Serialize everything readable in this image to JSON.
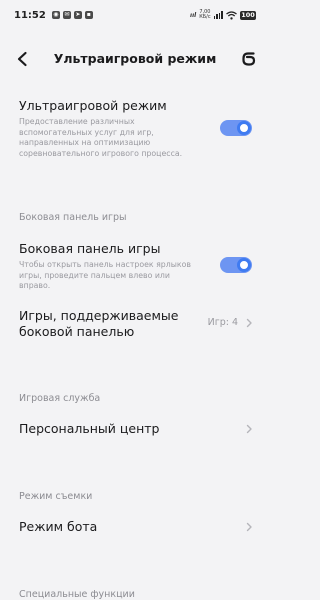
{
  "status_bar": {
    "time": "11:52",
    "network_speed_line1": "7,00",
    "network_speed_line2": "КБ/с",
    "battery": "100"
  },
  "header": {
    "title": "Ультраигровой режим"
  },
  "ultra_mode": {
    "title": "Ультраигровой режим",
    "description": "Предоставление различных вспомогательных услуг для игр, направленных на оптимизацию соревновательного игрового процесса.",
    "enabled": true
  },
  "side_panel_section": {
    "header": "Боковая панель игры",
    "toggle_title": "Боковая панель игры",
    "toggle_description": "Чтобы открыть панель настроек ярлыков игры, проведите пальцем влево или вправо.",
    "enabled": true,
    "supported_games_title": "Игры, поддерживаемые боковой панелью",
    "supported_games_value": "Игр: 4"
  },
  "game_service_section": {
    "header": "Игровая служба",
    "personal_center": "Персональный центр"
  },
  "shooting_mode_section": {
    "header": "Режим съемки",
    "bot_mode": "Режим бота"
  },
  "special_section": {
    "header": "Специальные функции"
  },
  "colors": {
    "accent": "#3f7bf1",
    "background": "#f3f3f5"
  }
}
